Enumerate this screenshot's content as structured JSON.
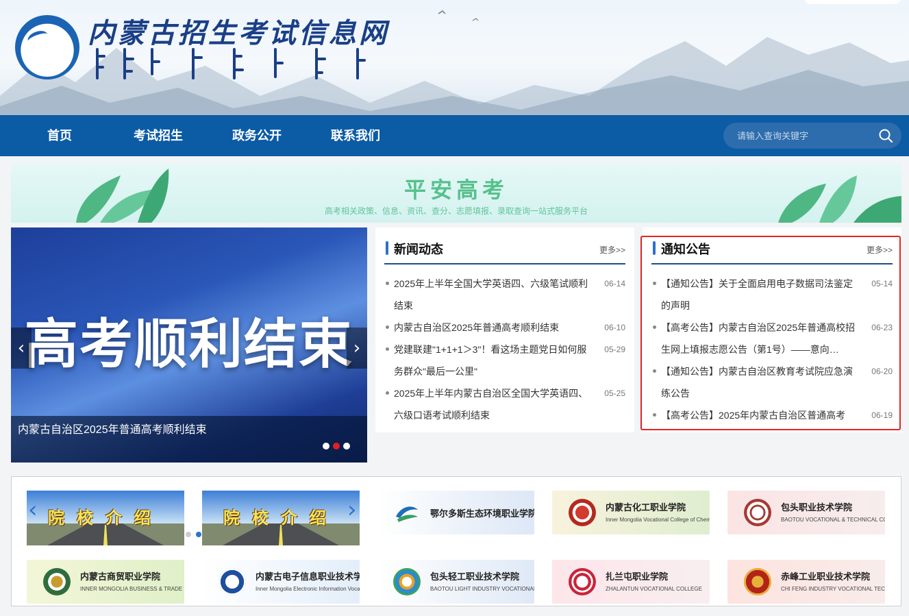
{
  "header": {
    "site_title": "内蒙古招生考试信息网",
    "logo_icon": "exam-authority-logo-icon",
    "mongol_script_icon": "mongolian-script-title-icon"
  },
  "nav": {
    "items": [
      {
        "label": "首页"
      },
      {
        "label": "考试招生"
      },
      {
        "label": "政务公开"
      },
      {
        "label": "联系我们"
      }
    ],
    "search_placeholder": "请输入查询关键字",
    "search_icon": "search-icon"
  },
  "banner": {
    "title": "平安高考",
    "subtitle": "高考相关政策、信息、资讯、查分、志愿填报、录取查询一站式服务平台"
  },
  "slider": {
    "headline": "高考顺利结束",
    "caption": "内蒙古自治区2025年普通高考顺利结束",
    "prev": "‹",
    "next": "›",
    "active_dot": 2,
    "dot_count": 3
  },
  "news": {
    "title": "新闻动态",
    "more": "更多>>",
    "items": [
      {
        "text": "2025年上半年全国大学英语四、六级笔试顺利结束",
        "date": "06-14"
      },
      {
        "text": "内蒙古自治区2025年普通高考顺利结束",
        "date": "06-10"
      },
      {
        "text": "党建联建\"1+1+1＞3\"！看这场主题党日如何服务群众\"最后一公里\"",
        "date": "05-29"
      },
      {
        "text": "2025年上半年内蒙古自治区全国大学英语四、六级口语考试顺利结束",
        "date": "05-25"
      }
    ]
  },
  "notices": {
    "title": "通知公告",
    "more": "更多>>",
    "items": [
      {
        "text": "【通知公告】关于全面启用电子数据司法鉴定的声明",
        "date": "05-14"
      },
      {
        "text": "【高考公告】内蒙古自治区2025年普通高校招生网上填报志愿公告（第1号）——意向…",
        "date": "06-23"
      },
      {
        "text": "【通知公告】内蒙古自治区教育考试院应急演练公告",
        "date": "06-20"
      },
      {
        "text": "【高考公告】2025年内蒙古自治区普通高考",
        "date": "06-19"
      }
    ]
  },
  "colleges": {
    "intro_label": "院校介绍",
    "prev": "‹",
    "next": "›",
    "row1": [
      {
        "name": "鄂尔多斯生态环境职业学院",
        "sub": ""
      },
      {
        "name": "内蒙古化工职业学院",
        "sub": "Inner Mongolia Vocational College of Chemical Engineering"
      },
      {
        "name": "包头职业技术学院",
        "sub": "BAOTOU VOCATIONAL & TECHNICAL COLLEGE"
      }
    ],
    "row2": [
      {
        "name": "内蒙古商贸职业学院",
        "sub": "INNER MONGOLIA BUSINESS & TRADE VOCATIONAL COLLEGE"
      },
      {
        "name": "内蒙古电子信息职业技术学院",
        "sub": "Inner Mongolia Electronic Information Vocational Technical College"
      },
      {
        "name": "包头轻工职业技术学院",
        "sub": "BAOTOU LIGHT INDUSTRY VOCATIONAL TECHNICAL COLLEGE"
      },
      {
        "name": "扎兰屯职业学院",
        "sub": "ZHALANTUN VOCATIONAL COLLEGE"
      },
      {
        "name": "赤峰工业职业技术学院",
        "sub": "CHI FENG INDUSTRY VOCATIONAL TECHNOLOGY COLLEGE"
      }
    ]
  },
  "colors": {
    "nav_bg": "#0c5ba5",
    "accent_blue": "#2e6fd0",
    "highlight_red": "#e52323",
    "banner_green": "#55c18d"
  }
}
